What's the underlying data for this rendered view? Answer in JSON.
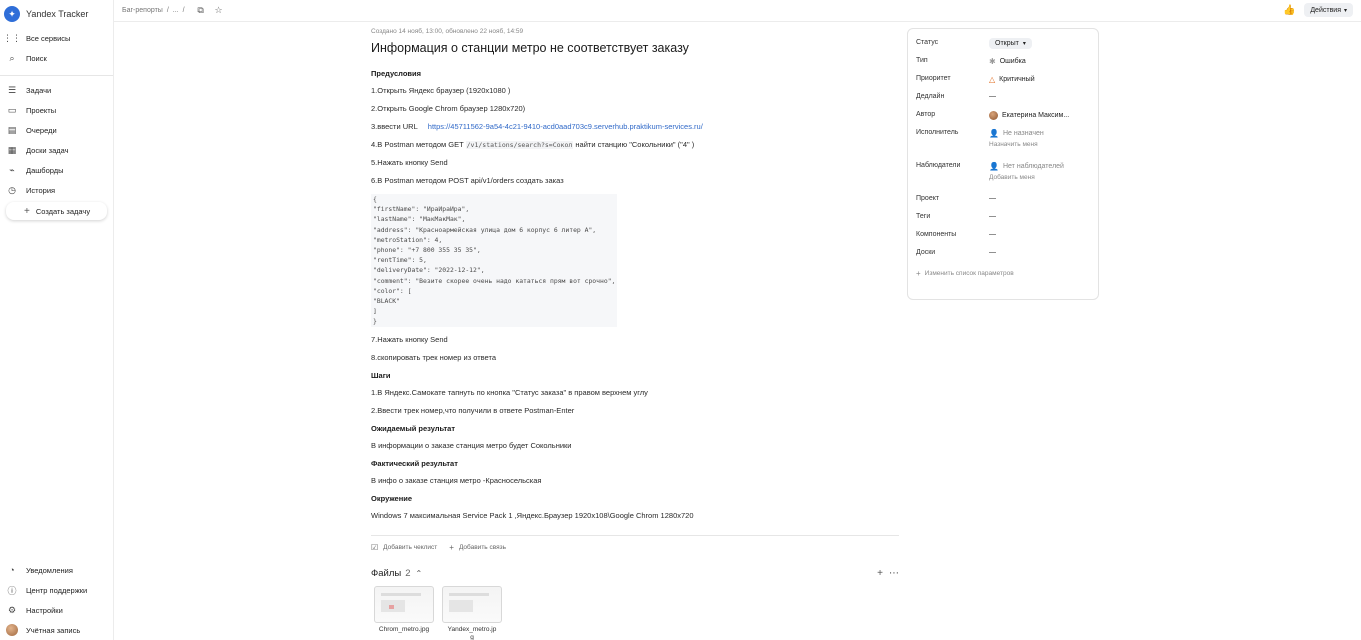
{
  "sidebar": {
    "brand": "Yandex Tracker",
    "top_items": [
      {
        "icon": "grid-icon",
        "label": "Все сервисы"
      },
      {
        "icon": "search-icon",
        "label": "Поиск"
      }
    ],
    "main_items": [
      {
        "icon": "tasks-icon",
        "label": "Задачи"
      },
      {
        "icon": "folder-icon",
        "label": "Проекты"
      },
      {
        "icon": "queue-icon",
        "label": "Очереди"
      },
      {
        "icon": "board-icon",
        "label": "Доски задач"
      },
      {
        "icon": "chart-icon",
        "label": "Дашборды"
      },
      {
        "icon": "clock-icon",
        "label": "История"
      }
    ],
    "create_label": "Создать задачу",
    "bottom_items": [
      {
        "icon": "bell-icon",
        "label": "Уведомления"
      },
      {
        "icon": "help-icon",
        "label": "Центр поддержки"
      },
      {
        "icon": "gear-icon",
        "label": "Настройки"
      },
      {
        "icon": "avatar",
        "label": "Учётная запись"
      }
    ]
  },
  "topbar": {
    "crumb_1": "Баг-репорты",
    "crumb_sep": "/",
    "crumb_2": "...",
    "crumb_3": "/",
    "actions_label": "Действия"
  },
  "issue": {
    "meta": "Создано 14 нояб, 13:00, обновлено 22 нояб, 14:59",
    "title": "Информация о станции метро не соответствует заказу",
    "preconditions_h": "Предусловия",
    "pre_1": "1.Открыть Яндекс браузер (1920х1080 )",
    "pre_2": "2.Открыть Google Chrom браузер 1280х720)",
    "pre_3_text": "3.ввести URL",
    "pre_3_link": "https://45711562-9a54-4c21-9410-acd0aad703c9.serverhub.praktikum-services.ru/",
    "pre_4_a": "4.В Postman методом GET",
    "pre_4_code": "/v1/stations/search?s=Сокол",
    "pre_4_b": "найти станцию \"Сокольники\" (\"4\" )",
    "pre_5": "5.Нажать кнопку Send",
    "pre_6": "6.В Postman методом POST api/v1/orders создать заказ",
    "code_block": "{\n\"firstName\": \"ИраИраИра\",\n\"lastName\": \"МакМакМак\",\n\"address\": \"Красноармейская улица дом 6 корпус 6 литер А\",\n\"metroStation\": 4,\n\"phone\": \"+7 800 355 35 35\",\n\"rentTime\": 5,\n\"deliveryDate\": \"2022-12-12\",\n\"comment\": \"Везите скорее очень надо кататься прям вот срочно\",\n\"color\": [\n\"BLACK\"\n]\n}",
    "pre_7": "7.Нажать кнопку Send",
    "pre_8": "8.скопировать трек номер из ответа",
    "steps_h": "Шаги",
    "step_1": "1.В Яндекс.Самокате тапнуть по кнопка \"Статус заказа\" в правом верхнем углу",
    "step_2": "2.Ввести трек номер,что получили в ответе Postman-Enter",
    "expected_h": "Ожидаемый результат",
    "expected": "В информации о заказе станция метро будет Сокольники",
    "actual_h": "Фактический результат",
    "actual": "В инфо о заказе станция метро -Красносельская",
    "env_h": "Окружение",
    "env": "Windows 7 максимальная Service Pack 1 ,Яндекс.Браузер 1920х108\\Google Chrom 1280х720",
    "add_checklist": "Добавить чеклист",
    "add_link": "Добавить связь",
    "files_title": "Файлы",
    "files_count": "2",
    "files": [
      {
        "name": "Chrom_metro.jpg"
      },
      {
        "name": "Yandex_metro.jp\ng"
      }
    ]
  },
  "panel": {
    "status_k": "Статус",
    "status_v": "Открыт",
    "type_k": "Тип",
    "type_v": "Ошибка",
    "priority_k": "Приоритет",
    "priority_v": "Критичный",
    "deadline_k": "Дедлайн",
    "deadline_v": "—",
    "author_k": "Автор",
    "author_v": "Екатерина Максим...",
    "assignee_k": "Исполнитель",
    "assignee_v": "Не назначен",
    "assignee_sub": "Назначить меня",
    "watchers_k": "Наблюдатели",
    "watchers_v": "Нет наблюдателей",
    "watchers_sub": "Добавить меня",
    "project_k": "Проект",
    "project_v": "—",
    "tags_k": "Теги",
    "tags_v": "—",
    "components_k": "Компоненты",
    "components_v": "—",
    "boards_k": "Доски",
    "boards_v": "—",
    "change_params": "Изменить список параметров"
  },
  "colors": {
    "accent": "#2f6ed8",
    "link": "#3069c8",
    "priority": "#e06c1f"
  }
}
